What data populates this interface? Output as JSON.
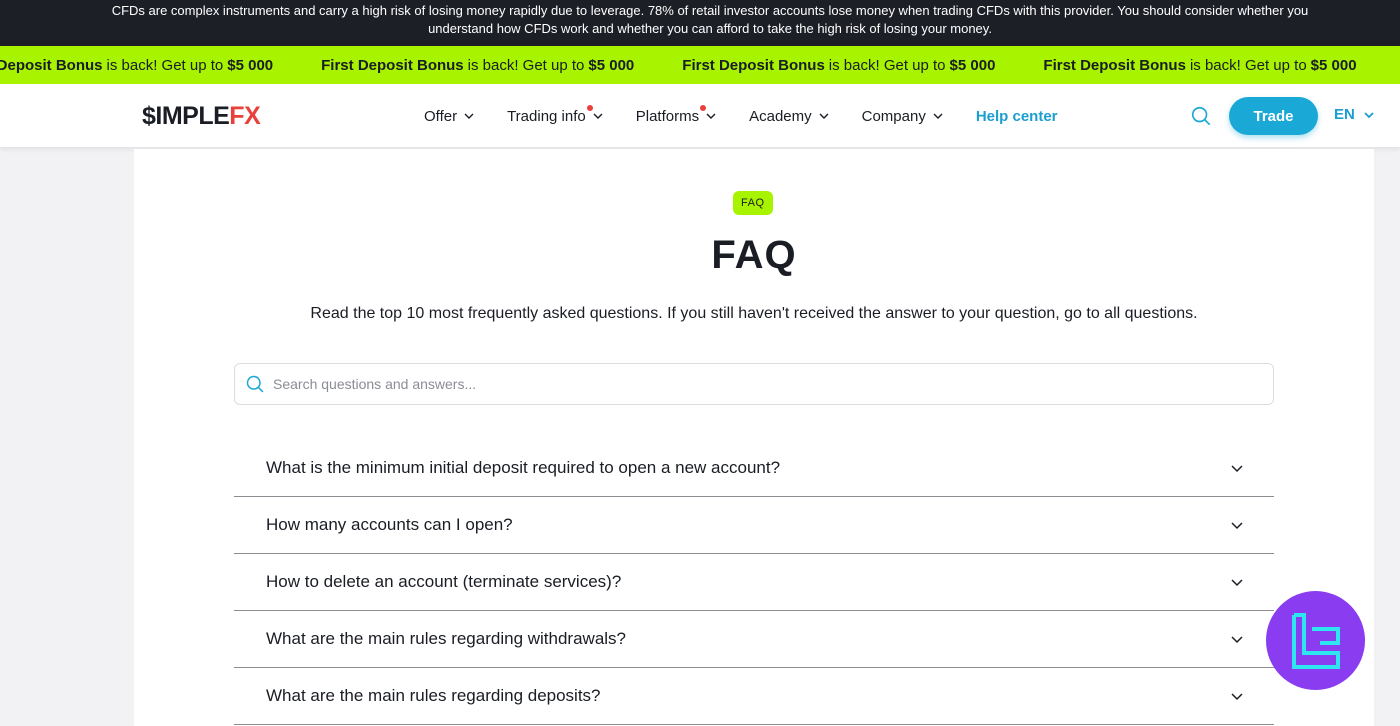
{
  "risk_warning": {
    "line1": "CFDs are complex instruments and carry a high risk of losing money rapidly due to leverage. 78% of retail investor accounts lose money when trading CFDs with this provider. You should consider whether you",
    "line2": "understand how CFDs work and whether you can afford to take the high risk of losing your money."
  },
  "promo": {
    "items": [
      {
        "bold1": "First Deposit Bonus",
        "middle": "is back! Get up to",
        "bold2": "$5 000"
      },
      {
        "bold1": "First Deposit Bonus",
        "middle": "is back! Get up to",
        "bold2": "$5 000"
      },
      {
        "bold1": "First Deposit Bonus",
        "middle": "is back! Get up to",
        "bold2": "$5 000"
      },
      {
        "bold1": "First Deposit Bonus",
        "middle": "is back! Get up to",
        "bold2": "$5 000"
      },
      {
        "bold1": "First Deposit Bonus",
        "middle": "is back! Get up to",
        "bold2": "$5 000"
      }
    ]
  },
  "header": {
    "logo_main": "$IMPLE",
    "logo_accent": "FX",
    "nav": [
      {
        "label": "Offer",
        "dot": false
      },
      {
        "label": "Trading info",
        "dot": true
      },
      {
        "label": "Platforms",
        "dot": true
      },
      {
        "label": "Academy",
        "dot": false
      },
      {
        "label": "Company",
        "dot": false
      }
    ],
    "help_label": "Help center",
    "trade_label": "Trade",
    "lang_label": "EN"
  },
  "faq": {
    "badge": "FAQ",
    "title": "FAQ",
    "subtitle": "Read the top 10 most frequently asked questions. If you still haven't received the answer to your question, go to all questions.",
    "search_placeholder": "Search questions and answers...",
    "questions": [
      "What is the minimum initial deposit required to open a new account?",
      "How many accounts can I open?",
      "How to delete an account (terminate services)?",
      "What are the main rules regarding withdrawals?",
      "What are the main rules regarding deposits?"
    ]
  },
  "colors": {
    "accent_green": "#a8f400",
    "accent_blue": "#1aa8d6",
    "brand_red": "#e8403a",
    "dark_bar": "#1d1f27",
    "tc_purple": "#8a3df0"
  }
}
